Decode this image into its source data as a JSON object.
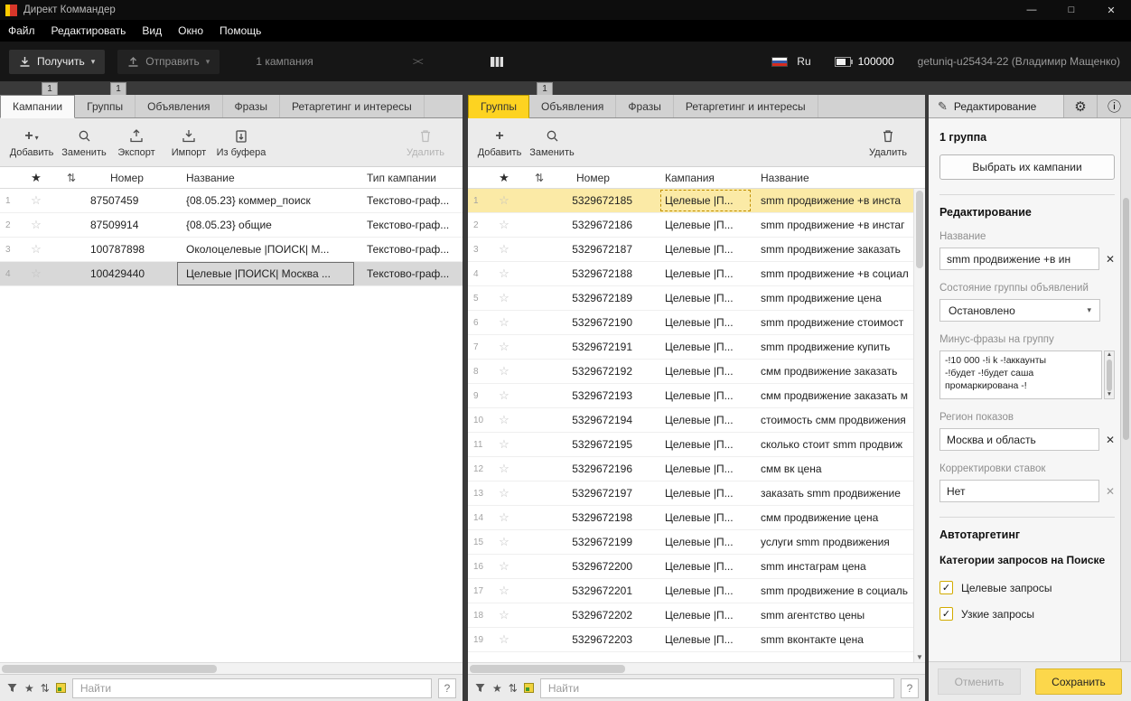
{
  "window": {
    "title": "Директ Коммандер",
    "controls": {
      "minimize": "—",
      "maximize": "□",
      "close": "✕"
    }
  },
  "menu": {
    "items": [
      "Файл",
      "Редактировать",
      "Вид",
      "Окно",
      "Помощь"
    ]
  },
  "icons": {
    "caret_down": "▾",
    "star": "★",
    "star_outline": "☆",
    "sort": "⇅",
    "collapse": "><",
    "pencil": "✎",
    "gear": "⚙",
    "info": "ⓘ",
    "clear": "✕",
    "check": "✓",
    "scroll_up": "▲",
    "scroll_down": "▼",
    "plus": "+"
  },
  "toolbar": {
    "get": "Получить",
    "send": "Отправить",
    "selection": "1 кампания",
    "lang": "Ru",
    "points": "100000",
    "account": "getuniq-u25434-22 (Владимир Мащенко)"
  },
  "left_panel": {
    "badges": [
      "1",
      "1"
    ],
    "tabs": [
      {
        "label": "Кампании",
        "cls": "active-white"
      },
      {
        "label": "Группы"
      },
      {
        "label": "Объявления"
      },
      {
        "label": "Фразы"
      },
      {
        "label": "Ретаргетинг и интересы"
      }
    ],
    "actions": {
      "add": "Добавить",
      "replace": "Заменить",
      "export": "Экспорт",
      "import": "Импорт",
      "buffer": "Из буфера",
      "delete": "Удалить"
    },
    "columns": {
      "number": "Номер",
      "name": "Название",
      "type": "Тип кампании"
    },
    "rows": [
      {
        "idx": "1",
        "number": "87507459",
        "name": "{08.05.23} коммер_поиск",
        "type": "Текстово-граф..."
      },
      {
        "idx": "2",
        "number": "87509914",
        "name": "{08.05.23} общие",
        "type": "Текстово-граф..."
      },
      {
        "idx": "3",
        "number": "100787898",
        "name": "Околоцелевые |ПОИСК| М...",
        "type": "Текстово-граф..."
      },
      {
        "idx": "4",
        "number": "100429440",
        "name": "Целевые |ПОИСК| Москва ...",
        "type": "Текстово-граф...",
        "cls": "selected"
      }
    ],
    "search": {
      "placeholder": "Найти",
      "help": "?"
    }
  },
  "mid_panel": {
    "badges": [
      "1"
    ],
    "tabs": [
      {
        "label": "Группы",
        "cls": "active-yellow"
      },
      {
        "label": "Объявления"
      },
      {
        "label": "Фразы"
      },
      {
        "label": "Ретаргетинг и интересы"
      }
    ],
    "actions": {
      "add": "Добавить",
      "replace": "Заменить",
      "delete": "Удалить"
    },
    "columns": {
      "number": "Номер",
      "campaign": "Кампания",
      "name": "Название"
    },
    "rows": [
      {
        "idx": "1",
        "number": "5329672185",
        "campaign": "Целевые |П...",
        "name": "smm продвижение +в инста",
        "cls": "selected dashed"
      },
      {
        "idx": "2",
        "number": "5329672186",
        "campaign": "Целевые |П...",
        "name": "smm продвижение +в инстаг"
      },
      {
        "idx": "3",
        "number": "5329672187",
        "campaign": "Целевые |П...",
        "name": "smm продвижение заказать"
      },
      {
        "idx": "4",
        "number": "5329672188",
        "campaign": "Целевые |П...",
        "name": "smm продвижение +в социал"
      },
      {
        "idx": "5",
        "number": "5329672189",
        "campaign": "Целевые |П...",
        "name": "smm продвижение цена"
      },
      {
        "idx": "6",
        "number": "5329672190",
        "campaign": "Целевые |П...",
        "name": "smm продвижение стоимост"
      },
      {
        "idx": "7",
        "number": "5329672191",
        "campaign": "Целевые |П...",
        "name": "smm продвижение купить"
      },
      {
        "idx": "8",
        "number": "5329672192",
        "campaign": "Целевые |П...",
        "name": "смм продвижение заказать"
      },
      {
        "idx": "9",
        "number": "5329672193",
        "campaign": "Целевые |П...",
        "name": "смм продвижение заказать м"
      },
      {
        "idx": "10",
        "number": "5329672194",
        "campaign": "Целевые |П...",
        "name": "стоимость смм продвижения"
      },
      {
        "idx": "11",
        "number": "5329672195",
        "campaign": "Целевые |П...",
        "name": "сколько стоит smm продвиж"
      },
      {
        "idx": "12",
        "number": "5329672196",
        "campaign": "Целевые |П...",
        "name": "смм вк цена"
      },
      {
        "idx": "13",
        "number": "5329672197",
        "campaign": "Целевые |П...",
        "name": "заказать smm продвижение"
      },
      {
        "idx": "14",
        "number": "5329672198",
        "campaign": "Целевые |П...",
        "name": "смм продвижение цена"
      },
      {
        "idx": "15",
        "number": "5329672199",
        "campaign": "Целевые |П...",
        "name": "услуги smm продвижения"
      },
      {
        "idx": "16",
        "number": "5329672200",
        "campaign": "Целевые |П...",
        "name": "smm инстаграм цена"
      },
      {
        "idx": "17",
        "number": "5329672201",
        "campaign": "Целевые |П...",
        "name": "smm продвижение в социаль"
      },
      {
        "idx": "18",
        "number": "5329672202",
        "campaign": "Целевые |П...",
        "name": "smm агентство цены"
      },
      {
        "idx": "19",
        "number": "5329672203",
        "campaign": "Целевые |П...",
        "name": "smm вконтакте цена"
      }
    ],
    "search": {
      "placeholder": "Найти",
      "help": "?"
    }
  },
  "edit_panel": {
    "header": "Редактирование",
    "summary": "1 группа",
    "select_campaigns": "Выбрать их кампании",
    "sections": {
      "editing": "Редактирование",
      "autotargeting": "Автотаргетинг"
    },
    "fields": {
      "name_label": "Название",
      "name_value": "smm продвижение +в ин",
      "state_label": "Состояние группы объявлений",
      "state_value": "Остановлено",
      "minus_label": "Минус-фразы на группу",
      "minus_value": "-!10 000 -!i k -!аккаунты\n-!будет -!будет саша\nпромаркирована -!",
      "region_label": "Регион показов",
      "region_value": "Москва и область",
      "bids_label": "Корректировки ставок",
      "bids_value": "Нет"
    },
    "categories_label": "Категории запросов на Поиске",
    "checkboxes": [
      {
        "label": "Целевые запросы"
      },
      {
        "label": "Узкие запросы"
      }
    ],
    "buttons": {
      "cancel": "Отменить",
      "save": "Сохранить"
    }
  }
}
